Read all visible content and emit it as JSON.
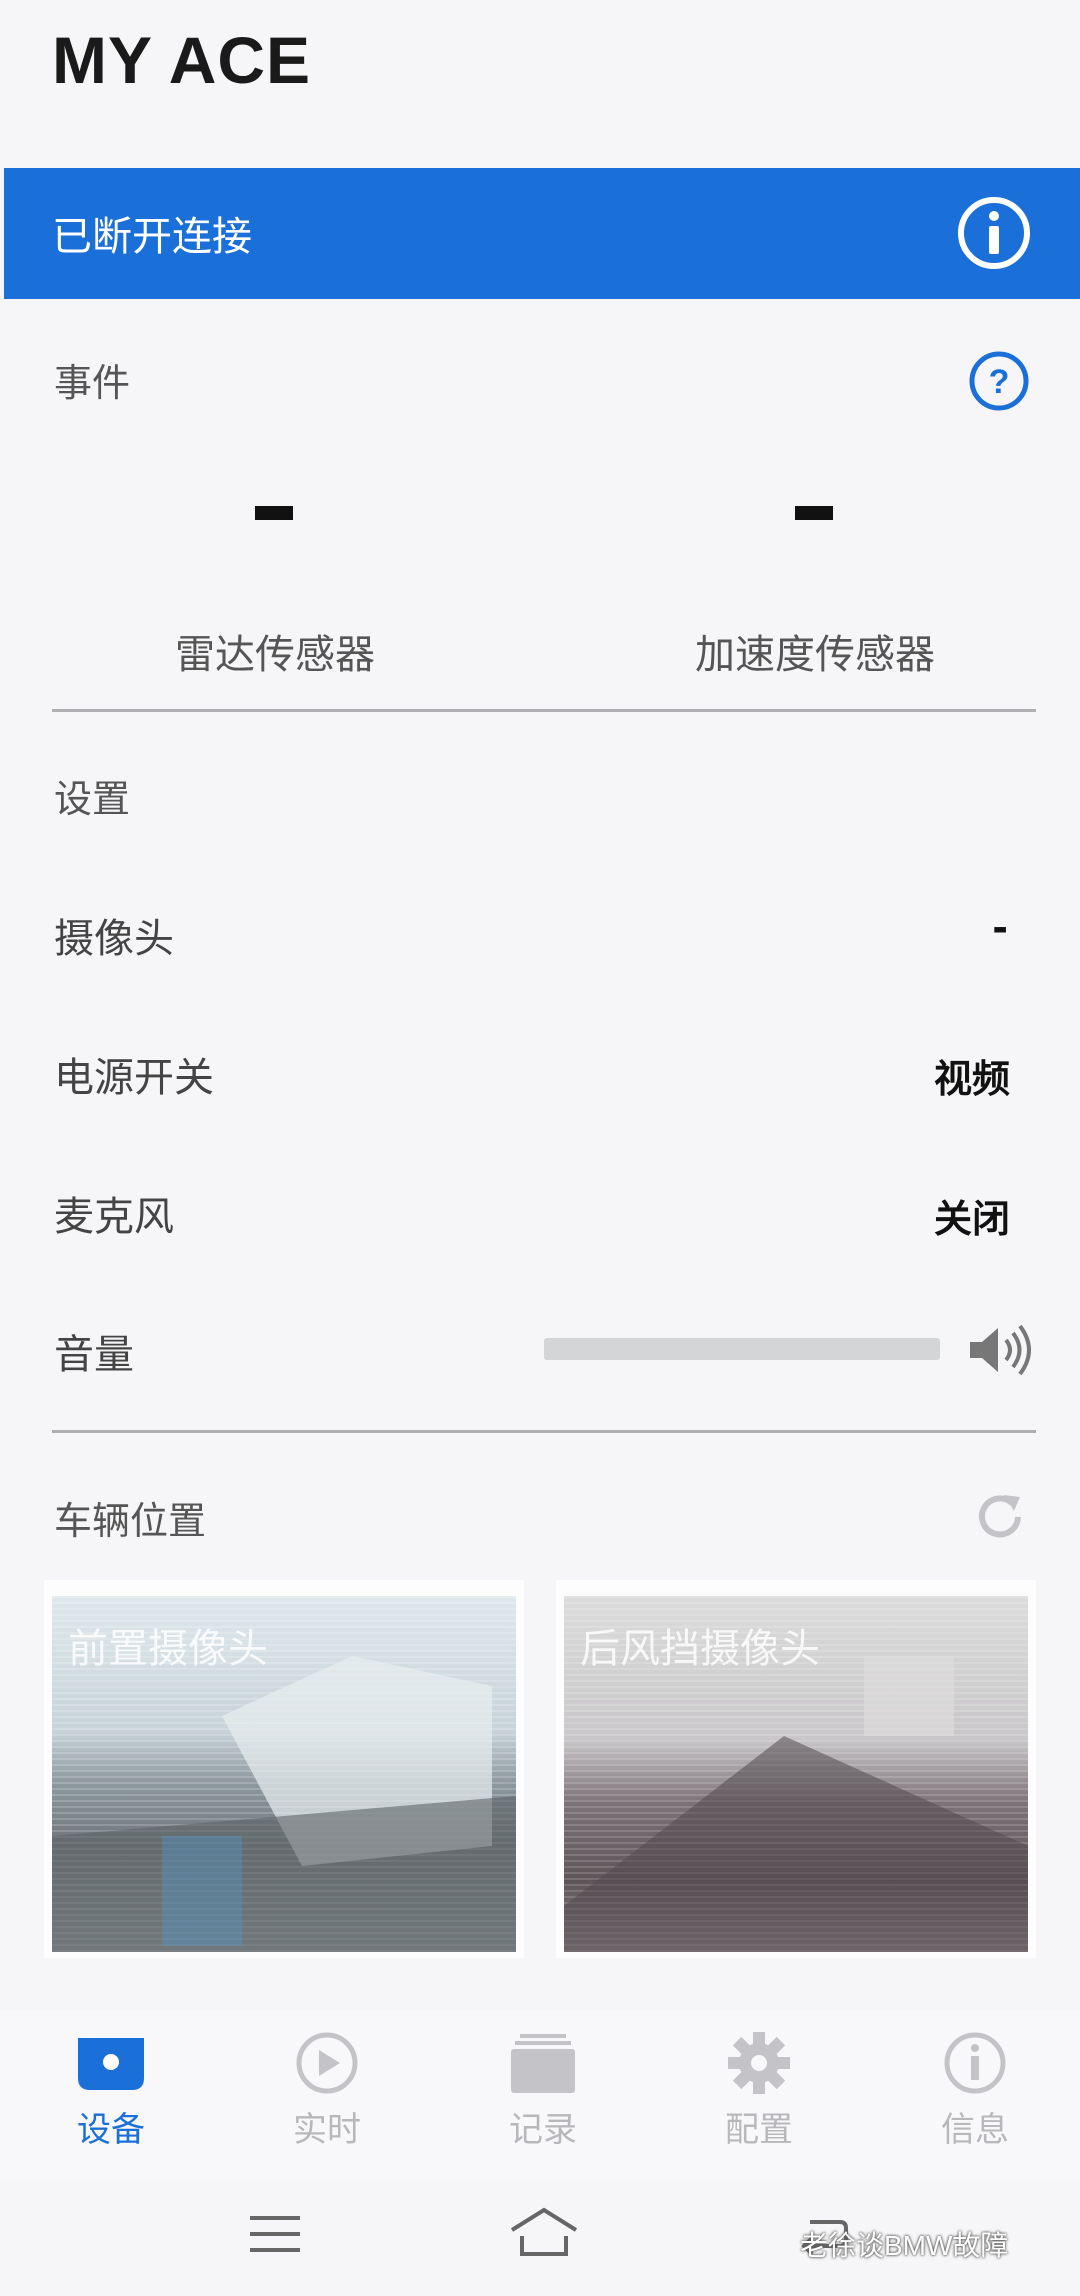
{
  "app": {
    "title": "MY ACE"
  },
  "status_banner": {
    "text": "已断开连接",
    "icon": "info-icon"
  },
  "events": {
    "label": "事件",
    "help_icon": "question-circle-icon",
    "sensors": [
      {
        "value": "-",
        "label": "雷达传感器"
      },
      {
        "value": "-",
        "label": "加速度传感器"
      }
    ]
  },
  "settings": {
    "label": "设置",
    "rows": [
      {
        "label": "摄像头",
        "value": "-"
      },
      {
        "label": "电源开关",
        "value": "视频"
      },
      {
        "label": "麦克风",
        "value": "关闭"
      }
    ],
    "volume": {
      "label": "音量",
      "icon": "speaker-icon"
    }
  },
  "vehicle_location": {
    "label": "车辆位置",
    "refresh_icon": "refresh-icon",
    "cameras": [
      {
        "label": "前置摄像头"
      },
      {
        "label": "后风挡摄像头"
      }
    ]
  },
  "bottom_nav": {
    "items": [
      {
        "label": "设备",
        "icon": "device-icon",
        "active": true
      },
      {
        "label": "实时",
        "icon": "play-icon",
        "active": false
      },
      {
        "label": "记录",
        "icon": "records-icon",
        "active": false
      },
      {
        "label": "配置",
        "icon": "gear-icon",
        "active": false
      },
      {
        "label": "信息",
        "icon": "info-icon",
        "active": false
      }
    ]
  },
  "watermark": {
    "text": "老徐谈BMW故障"
  },
  "colors": {
    "accent": "#1b6fd8",
    "inactive": "#b8b8bc",
    "background": "#f6f6f8"
  }
}
